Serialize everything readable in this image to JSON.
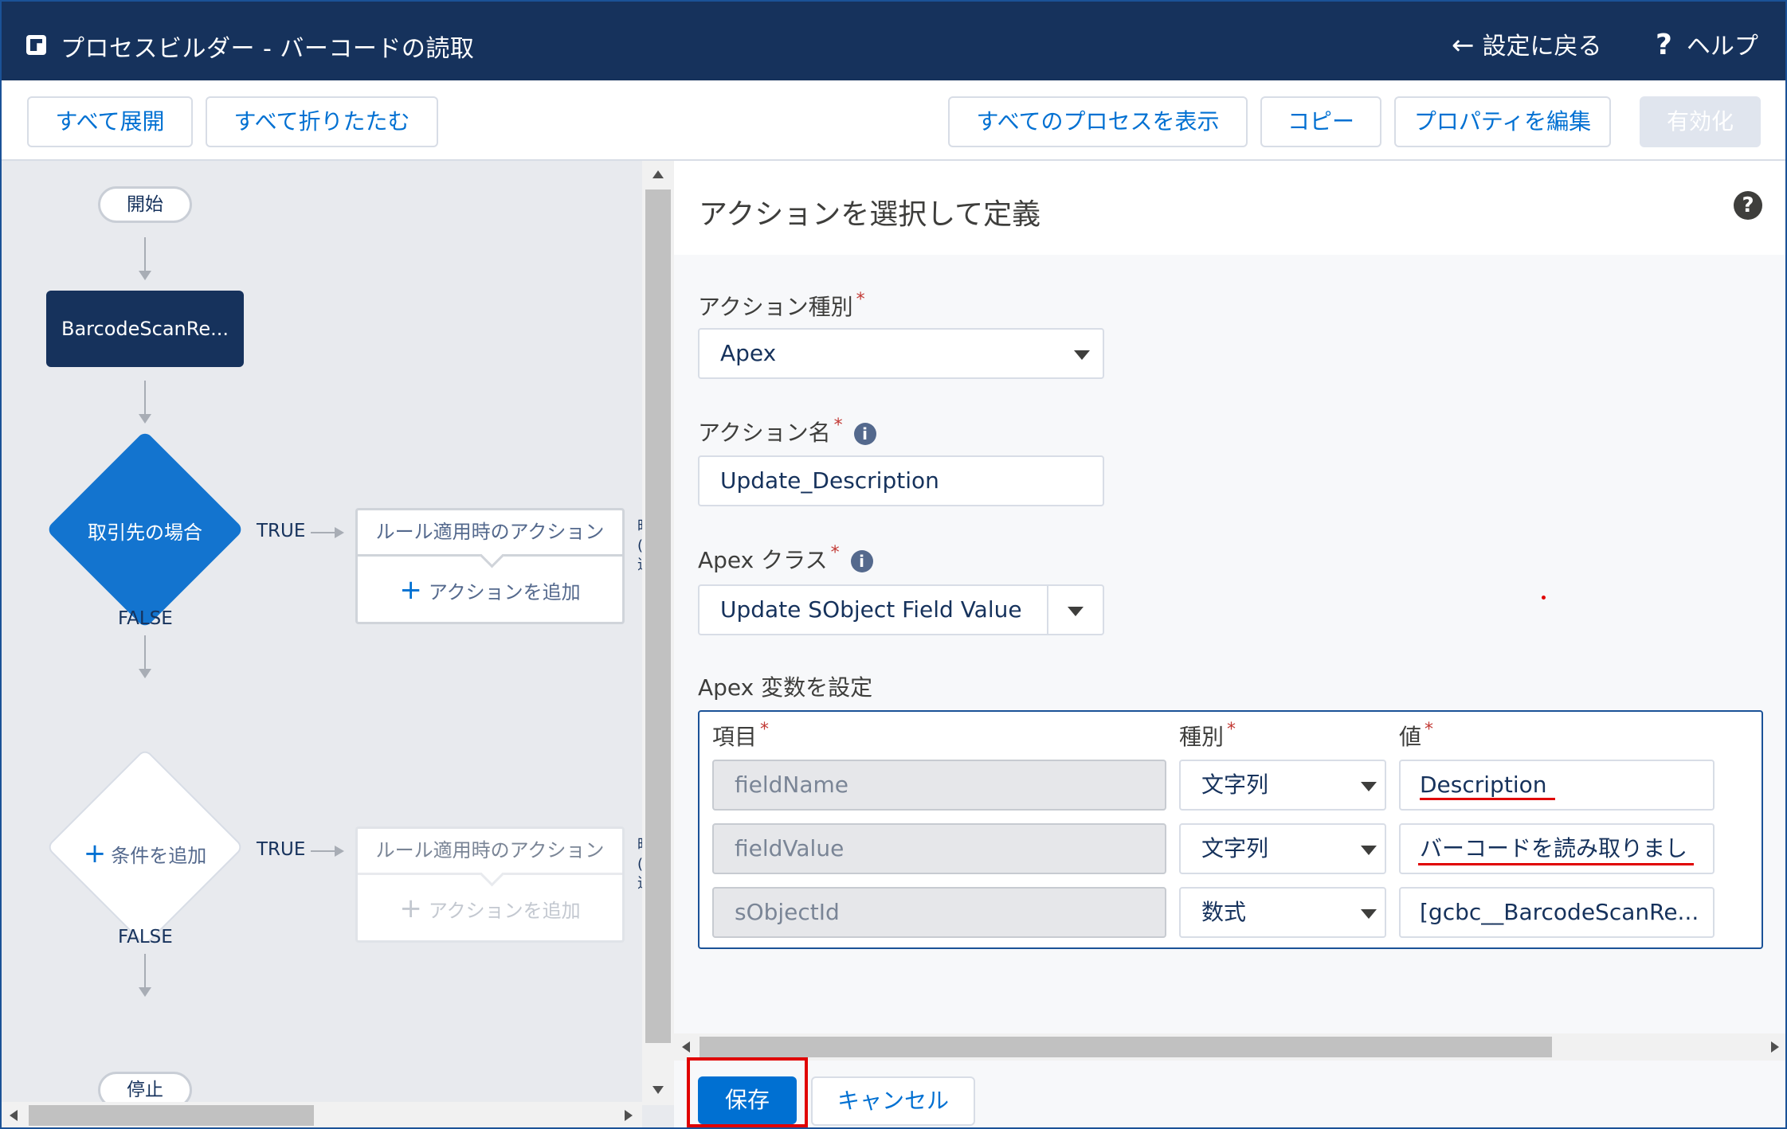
{
  "header": {
    "title": "プロセスビルダー - バーコードの読取",
    "back_label": "設定に戻る",
    "help_label": "ヘルプ"
  },
  "toolbar": {
    "expand_all": "すべて展開",
    "collapse_all": "すべて折りたたむ",
    "view_all_processes": "すべてのプロセスを表示",
    "copy": "コピー",
    "edit_properties": "プロパティを編集",
    "activate": "有効化"
  },
  "canvas": {
    "start": "開始",
    "object_node": "BarcodeScanRe...",
    "criteria1": "取引先の場合",
    "criteria2": "条件を追加",
    "true_label": "TRUE",
    "false_label": "FALSE",
    "immediate_actions": "ルール適用時のアクション",
    "add_action": "アクションを追加",
    "stop": "停止",
    "cut_text": "時\n(\n追"
  },
  "panel": {
    "title": "アクションを選択して定義",
    "action_type_label": "アクション種別",
    "action_type_value": "Apex",
    "action_name_label": "アクション名",
    "action_name_value": "Update_Description",
    "apex_class_label": "Apex クラス",
    "apex_class_value": "Update SObject Field Value",
    "apex_vars_label": "Apex 変数を設定",
    "col_field": "項目",
    "col_type": "種別",
    "col_value": "値",
    "required_mark": "*",
    "rows": [
      {
        "field": "fieldName",
        "type": "文字列",
        "value": "Description"
      },
      {
        "field": "fieldValue",
        "type": "文字列",
        "value": "バーコードを読み取りまし"
      },
      {
        "field": "sObjectId",
        "type": "数式",
        "value": "[gcbc__BarcodeScanRe..."
      }
    ],
    "save": "保存",
    "cancel": "キャンセル"
  },
  "colors": {
    "header_bg": "#16325c",
    "brand_blue": "#0070d2",
    "criteria_blue": "#1374cf",
    "highlight_red": "#e00000"
  }
}
